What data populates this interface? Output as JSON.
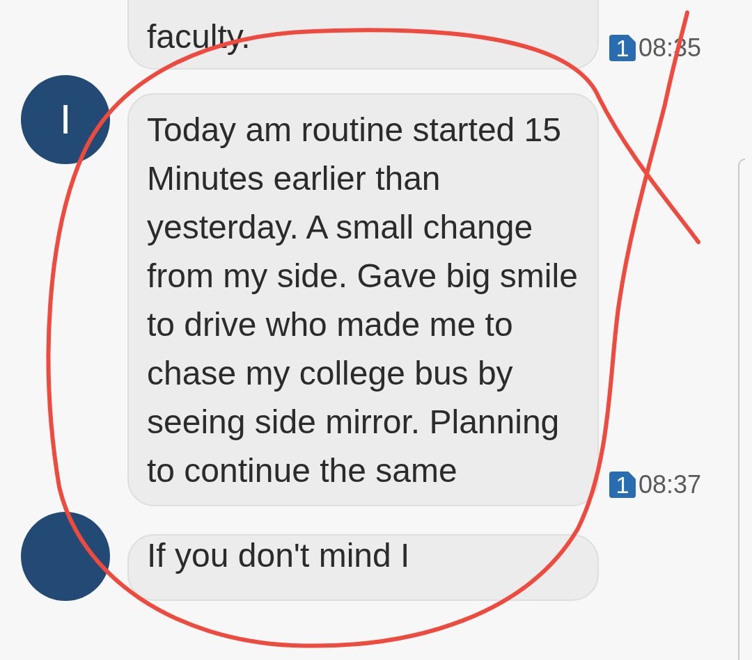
{
  "messages": [
    {
      "avatar": false,
      "text": "faculty.",
      "sim": "1",
      "time": "08:35"
    },
    {
      "avatar": true,
      "sender_initial": "I",
      "text": "Today am routine started 15 Minutes earlier than yesterday. A small change from my side. Gave big smile to drive who made me to chase my college bus by seeing side mirror. Planning to continue the same",
      "sim": "1",
      "time": "08:37"
    },
    {
      "avatar": true,
      "text": "If you don't mind I"
    }
  ]
}
